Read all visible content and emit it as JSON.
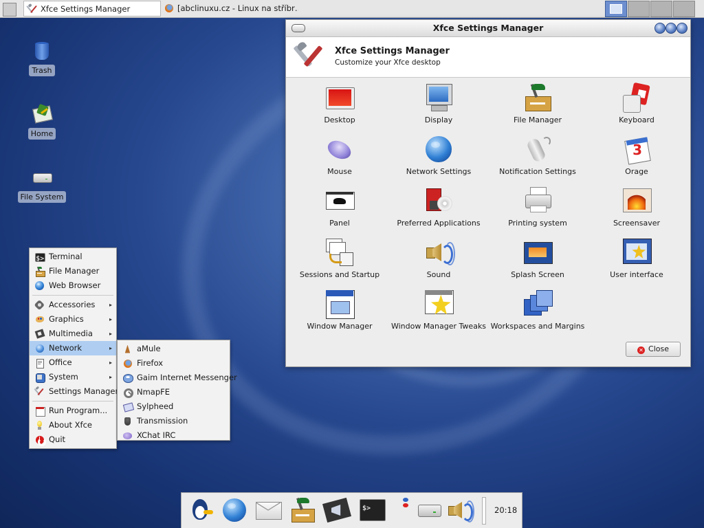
{
  "taskbar": {
    "tasks": [
      {
        "label": "Xfce Settings Manager",
        "icon": "tools-icon",
        "active": true
      },
      {
        "label": "[abclinuxu.cz - Linux na stříbr…",
        "icon": "firefox-icon",
        "active": false
      }
    ],
    "workspaces": 4,
    "current_workspace": 1
  },
  "desktop": {
    "icons": [
      {
        "label": "Trash",
        "icon": "trash-icon"
      },
      {
        "label": "Home",
        "icon": "home-icon"
      },
      {
        "label": "File System",
        "icon": "drive-icon"
      }
    ]
  },
  "window": {
    "title": "Xfce Settings Manager",
    "header_title": "Xfce Settings Manager",
    "header_subtitle": "Customize your Xfce desktop",
    "items": [
      {
        "label": "Desktop",
        "icon": "desktop-icon"
      },
      {
        "label": "Display",
        "icon": "display-icon"
      },
      {
        "label": "File Manager",
        "icon": "file-manager-icon"
      },
      {
        "label": "Keyboard",
        "icon": "keyboard-icon"
      },
      {
        "label": "Mouse",
        "icon": "mouse-icon"
      },
      {
        "label": "Network Settings",
        "icon": "globe-icon"
      },
      {
        "label": "Notification Settings",
        "icon": "notification-icon"
      },
      {
        "label": "Orage",
        "icon": "calendar-icon"
      },
      {
        "label": "Panel",
        "icon": "panel-icon"
      },
      {
        "label": "Preferred Applications",
        "icon": "preferred-apps-icon"
      },
      {
        "label": "Printing system",
        "icon": "printer-icon"
      },
      {
        "label": "Screensaver",
        "icon": "screensaver-icon"
      },
      {
        "label": "Sessions and Startup",
        "icon": "sessions-icon"
      },
      {
        "label": "Sound",
        "icon": "speaker-icon"
      },
      {
        "label": "Splash Screen",
        "icon": "splash-icon"
      },
      {
        "label": "User interface",
        "icon": "user-interface-icon"
      },
      {
        "label": "Window Manager",
        "icon": "window-manager-icon"
      },
      {
        "label": "Window Manager Tweaks",
        "icon": "wm-tweaks-icon"
      },
      {
        "label": "Workspaces and Margins",
        "icon": "workspaces-icon"
      }
    ],
    "close_label": "Close"
  },
  "root_menu": {
    "sections": [
      [
        {
          "label": "Terminal",
          "icon": "terminal-icon",
          "submenu": false
        },
        {
          "label": "File Manager",
          "icon": "file-manager-icon",
          "submenu": false
        },
        {
          "label": "Web Browser",
          "icon": "globe-icon",
          "submenu": false
        }
      ],
      [
        {
          "label": "Accessories",
          "icon": "accessories-icon",
          "submenu": true
        },
        {
          "label": "Graphics",
          "icon": "graphics-icon",
          "submenu": true
        },
        {
          "label": "Multimedia",
          "icon": "multimedia-icon",
          "submenu": true
        },
        {
          "label": "Network",
          "icon": "network-icon",
          "submenu": true,
          "highlighted": true
        },
        {
          "label": "Office",
          "icon": "office-icon",
          "submenu": true
        },
        {
          "label": "System",
          "icon": "system-icon",
          "submenu": true
        },
        {
          "label": "Settings Manager",
          "icon": "tools-icon",
          "submenu": false
        }
      ],
      [
        {
          "label": "Run Program...",
          "icon": "run-icon",
          "submenu": false
        },
        {
          "label": "About Xfce",
          "icon": "about-icon",
          "submenu": false
        },
        {
          "label": "Quit",
          "icon": "quit-icon",
          "submenu": false
        }
      ]
    ]
  },
  "network_submenu": {
    "items": [
      {
        "label": "aMule",
        "icon": "amule-icon"
      },
      {
        "label": "Firefox",
        "icon": "firefox-icon"
      },
      {
        "label": "Gaim Internet Messenger",
        "icon": "gaim-icon"
      },
      {
        "label": "NmapFE",
        "icon": "magnifier-icon"
      },
      {
        "label": "Sylpheed",
        "icon": "sylpheed-icon"
      },
      {
        "label": "Transmission",
        "icon": "transmission-icon"
      },
      {
        "label": "XChat IRC",
        "icon": "xchat-icon"
      }
    ]
  },
  "dock": {
    "launchers": [
      {
        "icon": "xfce-mouse-icon"
      },
      {
        "icon": "globe-icon"
      },
      {
        "icon": "mail-icon"
      },
      {
        "icon": "file-manager-icon"
      },
      {
        "icon": "media-player-icon"
      },
      {
        "icon": "terminal-icon"
      },
      {
        "icon": "lock-icon"
      },
      {
        "icon": "drive-icon"
      },
      {
        "icon": "speaker-icon"
      }
    ],
    "clock": "20:18"
  },
  "colors": {
    "highlight": "#aecdf1",
    "panel": "#e6e6e6",
    "window_bg": "#ededed"
  }
}
